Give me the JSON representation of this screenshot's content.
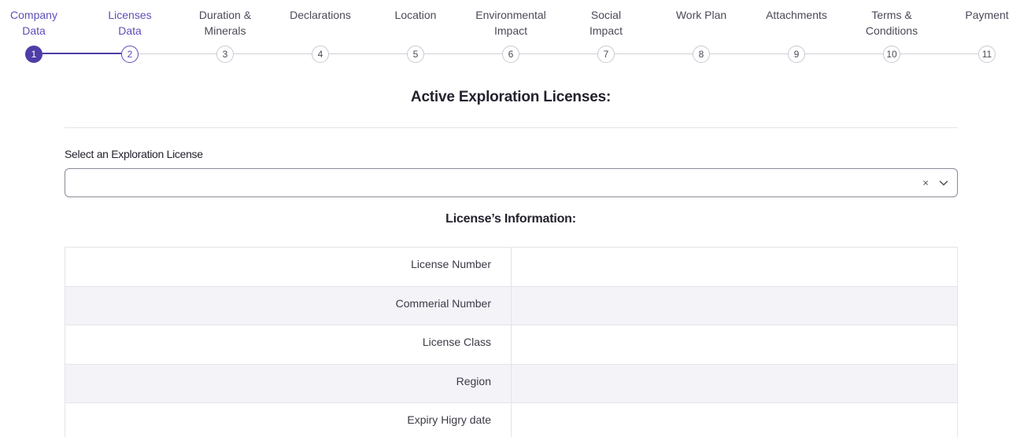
{
  "stepper": {
    "steps": [
      {
        "label_line1": "Company",
        "label_line2": "Data",
        "number": "1",
        "state": "done"
      },
      {
        "label_line1": "Licenses",
        "label_line2": "Data",
        "number": "2",
        "state": "active"
      },
      {
        "label_line1": "Duration &",
        "label_line2": "Minerals",
        "number": "3",
        "state": "pending"
      },
      {
        "label_line1": "Declarations",
        "label_line2": "",
        "number": "4",
        "state": "pending"
      },
      {
        "label_line1": "Location",
        "label_line2": "",
        "number": "5",
        "state": "pending"
      },
      {
        "label_line1": "Environmental",
        "label_line2": "Impact",
        "number": "6",
        "state": "pending"
      },
      {
        "label_line1": "Social",
        "label_line2": "Impact",
        "number": "7",
        "state": "pending"
      },
      {
        "label_line1": "Work Plan",
        "label_line2": "",
        "number": "8",
        "state": "pending"
      },
      {
        "label_line1": "Attachments",
        "label_line2": "",
        "number": "9",
        "state": "pending"
      },
      {
        "label_line1": "Terms &",
        "label_line2": "Conditions",
        "number": "10",
        "state": "pending"
      },
      {
        "label_line1": "Payment",
        "label_line2": "",
        "number": "11",
        "state": "pending"
      }
    ]
  },
  "main": {
    "title": "Active Exploration Licenses:",
    "select_label": "Select an Exploration License",
    "select_value": "",
    "select_clear": "×",
    "info_title": "License’s Information:",
    "info_rows": [
      {
        "key": "License Number",
        "value": ""
      },
      {
        "key": "Commerial Number",
        "value": ""
      },
      {
        "key": "License Class",
        "value": ""
      },
      {
        "key": "Region",
        "value": ""
      },
      {
        "key": "Expiry Higry date",
        "value": ""
      }
    ]
  },
  "colors": {
    "accent": "#4f3da8",
    "accent_text": "#5b4fb8",
    "border": "#e4e4ea",
    "row_alt": "#f3f3f8"
  }
}
